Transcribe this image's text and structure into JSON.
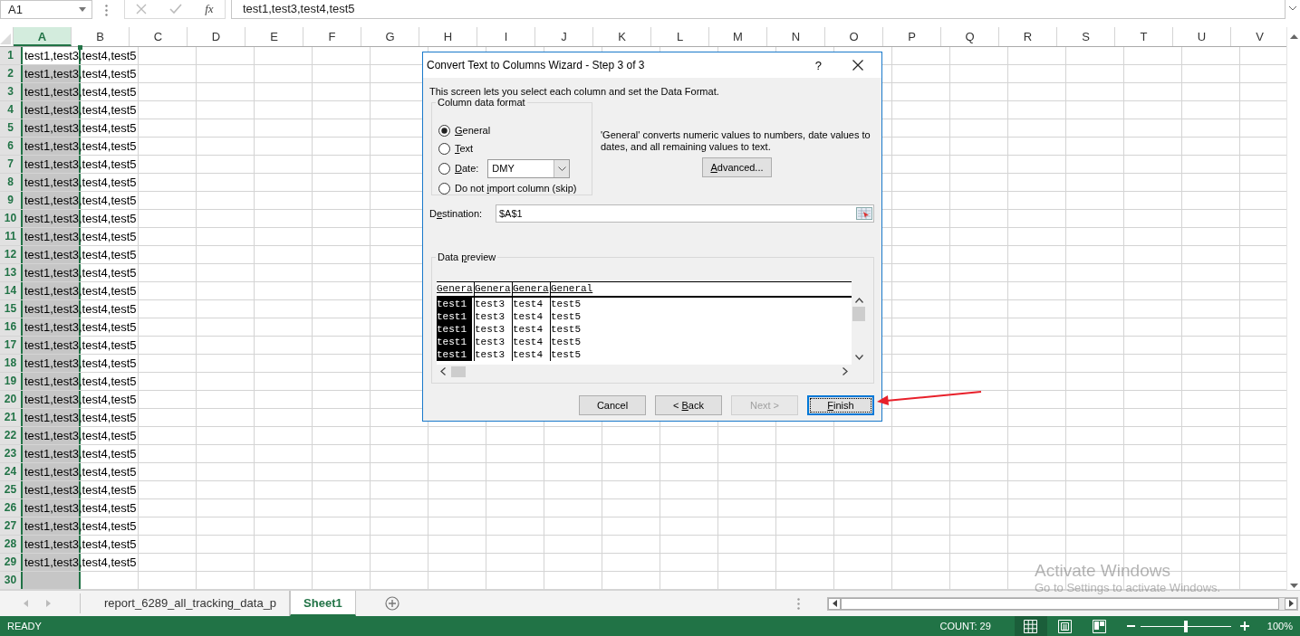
{
  "name_box": "A1",
  "function_label": "fx",
  "formula": "test1,test3,test4,test5",
  "columns": [
    {
      "label": "A",
      "selected": true
    },
    {
      "label": "B",
      "selected": false
    },
    {
      "label": "C",
      "selected": false
    },
    {
      "label": "D",
      "selected": false
    },
    {
      "label": "E",
      "selected": false
    },
    {
      "label": "F",
      "selected": false
    },
    {
      "label": "G",
      "selected": false
    },
    {
      "label": "H",
      "selected": false
    },
    {
      "label": "I",
      "selected": false
    },
    {
      "label": "J",
      "selected": false
    },
    {
      "label": "K",
      "selected": false
    },
    {
      "label": "L",
      "selected": false
    },
    {
      "label": "M",
      "selected": false
    },
    {
      "label": "N",
      "selected": false
    },
    {
      "label": "O",
      "selected": false
    },
    {
      "label": "P",
      "selected": false
    },
    {
      "label": "Q",
      "selected": false
    },
    {
      "label": "R",
      "selected": false
    },
    {
      "label": "S",
      "selected": false
    },
    {
      "label": "T",
      "selected": false
    },
    {
      "label": "U",
      "selected": false
    },
    {
      "label": "V",
      "selected": false
    }
  ],
  "rows": [
    {
      "number": "1",
      "selected": true,
      "active": true,
      "value": "test1,test3,test4,test5"
    },
    {
      "number": "2",
      "selected": true,
      "active": false,
      "value": "test1,test3,test4,test5"
    },
    {
      "number": "3",
      "selected": true,
      "active": false,
      "value": "test1,test3,test4,test5"
    },
    {
      "number": "4",
      "selected": true,
      "active": false,
      "value": "test1,test3,test4,test5"
    },
    {
      "number": "5",
      "selected": true,
      "active": false,
      "value": "test1,test3,test4,test5"
    },
    {
      "number": "6",
      "selected": true,
      "active": false,
      "value": "test1,test3,test4,test5"
    },
    {
      "number": "7",
      "selected": true,
      "active": false,
      "value": "test1,test3,test4,test5"
    },
    {
      "number": "8",
      "selected": true,
      "active": false,
      "value": "test1,test3,test4,test5"
    },
    {
      "number": "9",
      "selected": true,
      "active": false,
      "value": "test1,test3,test4,test5"
    },
    {
      "number": "10",
      "selected": true,
      "active": false,
      "value": "test1,test3,test4,test5"
    },
    {
      "number": "11",
      "selected": true,
      "active": false,
      "value": "test1,test3,test4,test5"
    },
    {
      "number": "12",
      "selected": true,
      "active": false,
      "value": "test1,test3,test4,test5"
    },
    {
      "number": "13",
      "selected": true,
      "active": false,
      "value": "test1,test3,test4,test5"
    },
    {
      "number": "14",
      "selected": true,
      "active": false,
      "value": "test1,test3,test4,test5"
    },
    {
      "number": "15",
      "selected": true,
      "active": false,
      "value": "test1,test3,test4,test5"
    },
    {
      "number": "16",
      "selected": true,
      "active": false,
      "value": "test1,test3,test4,test5"
    },
    {
      "number": "17",
      "selected": true,
      "active": false,
      "value": "test1,test3,test4,test5"
    },
    {
      "number": "18",
      "selected": true,
      "active": false,
      "value": "test1,test3,test4,test5"
    },
    {
      "number": "19",
      "selected": true,
      "active": false,
      "value": "test1,test3,test4,test5"
    },
    {
      "number": "20",
      "selected": true,
      "active": false,
      "value": "test1,test3,test4,test5"
    },
    {
      "number": "21",
      "selected": true,
      "active": false,
      "value": "test1,test3,test4,test5"
    },
    {
      "number": "22",
      "selected": true,
      "active": false,
      "value": "test1,test3,test4,test5"
    },
    {
      "number": "23",
      "selected": true,
      "active": false,
      "value": "test1,test3,test4,test5"
    },
    {
      "number": "24",
      "selected": true,
      "active": false,
      "value": "test1,test3,test4,test5"
    },
    {
      "number": "25",
      "selected": true,
      "active": false,
      "value": "test1,test3,test4,test5"
    },
    {
      "number": "26",
      "selected": true,
      "active": false,
      "value": "test1,test3,test4,test5"
    },
    {
      "number": "27",
      "selected": true,
      "active": false,
      "value": "test1,test3,test4,test5"
    },
    {
      "number": "28",
      "selected": true,
      "active": false,
      "value": "test1,test3,test4,test5"
    },
    {
      "number": "29",
      "selected": true,
      "active": false,
      "value": "test1,test3,test4,test5"
    },
    {
      "number": "30",
      "selected": true,
      "active": false
    }
  ],
  "dialog": {
    "title": "Convert Text to Columns Wizard - Step 3 of 3",
    "help": "?",
    "intro": "This screen lets you select each column and set the Data Format.",
    "format_group": {
      "legend": "Column data format",
      "options": [
        {
          "kind": "plain",
          "key": "G",
          "post": "eneral",
          "selected": true
        },
        {
          "kind": "plain",
          "key": "T",
          "post": "ext",
          "selected": false
        },
        {
          "kind": "date",
          "key": "D",
          "post": "ate:",
          "selected": false,
          "select_value": "DMY"
        },
        {
          "kind": "plain",
          "pre": "Do not ",
          "key": "i",
          "post": "mport column (skip)",
          "selected": false
        }
      ]
    },
    "description": "'General' converts numeric values to numbers, date values to dates, and all remaining values to text.",
    "advanced_button": {
      "key": "A",
      "post": "dvanced..."
    },
    "destination": {
      "pre": "D",
      "key": "e",
      "post": "stination:",
      "value": "$A$1"
    },
    "preview": {
      "legend_pre": "Data ",
      "legend_key": "p",
      "legend_post": "review",
      "headers": [
        {
          "label": "Genera",
          "selected": true
        },
        {
          "label": "Genera",
          "selected": false
        },
        {
          "label": "Genera",
          "selected": false
        },
        {
          "label": "General",
          "selected": false
        }
      ],
      "rows": [
        [
          "test1",
          "test3",
          "test4",
          "test5"
        ],
        [
          "test1",
          "test3",
          "test4",
          "test5"
        ],
        [
          "test1",
          "test3",
          "test4",
          "test5"
        ],
        [
          "test1",
          "test3",
          "test4",
          "test5"
        ],
        [
          "test1",
          "test3",
          "test4",
          "test5"
        ]
      ]
    },
    "buttons": [
      {
        "post": "Cancel",
        "disabled": false,
        "default": false
      },
      {
        "pre": "< ",
        "key": "B",
        "post": "ack",
        "disabled": false,
        "default": false
      },
      {
        "post": "Next >",
        "disabled": true,
        "default": false
      },
      {
        "key": "F",
        "post": "inish",
        "disabled": false,
        "default": true
      }
    ]
  },
  "sheet_tabs": [
    {
      "label": "report_6289_all_tracking_data_p",
      "selected": false
    },
    {
      "label": "Sheet1",
      "selected": true
    }
  ],
  "status": {
    "mode": "READY",
    "count": "COUNT: 29",
    "views": [
      {
        "kind": "normal",
        "selected": true
      },
      {
        "kind": "layout",
        "selected": false
      },
      {
        "kind": "pagebreak",
        "selected": false
      }
    ],
    "zoom": {
      "level": 0.5,
      "reading": "100%"
    }
  },
  "activation_notice": {
    "title": "Activate Windows",
    "text": "Go to Settings to activate Windows."
  }
}
